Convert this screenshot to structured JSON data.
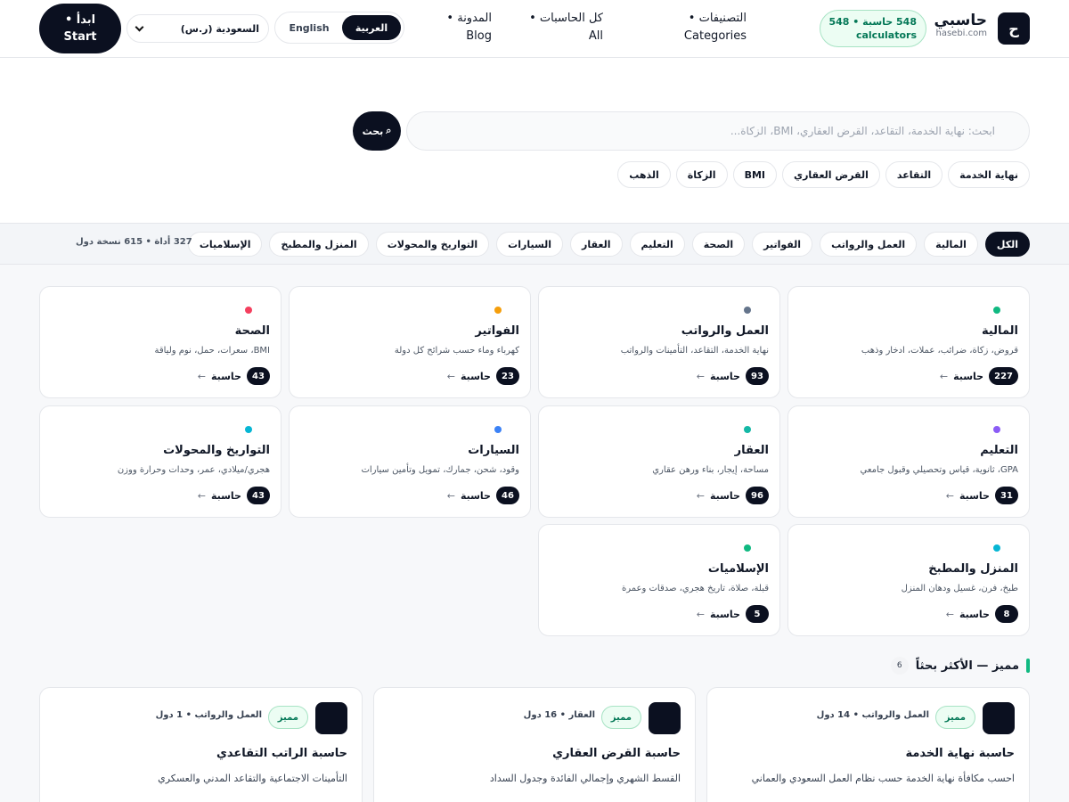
{
  "header": {
    "logo_glyph": "ح",
    "brand_name": "حاسبي",
    "brand_domain": "hasebi.com",
    "count_line1": "548 حاسبة • 548",
    "count_line2": "calculators",
    "nav_categories": "التصنيفات • Categories",
    "nav_all": "كل الحاسبات • All",
    "nav_blog": "المدونة • Blog",
    "lang_ar": "العربية",
    "lang_en": "English",
    "country": "السعودية (ر.س)",
    "start_line1": "ابدأ •",
    "start_line2": "Start"
  },
  "search": {
    "placeholder": "ابحث: نهاية الخدمة، التقاعد، القرض العقاري، BMI، الزكاة...",
    "button_label": "بحث",
    "quick_chips": [
      "نهاية الخدمة",
      "التقاعد",
      "القرض العقاري",
      "BMI",
      "الزكاة",
      "الذهب"
    ]
  },
  "filters": {
    "items": [
      "الكل",
      "المالية",
      "العمل والرواتب",
      "الفواتير",
      "الصحة",
      "التعليم",
      "العقار",
      "السيارات",
      "التواريخ والمحولات",
      "المنزل والمطبخ",
      "الإسلاميات"
    ],
    "stats": "327 أداة • 615 نسخة دول"
  },
  "categories": [
    {
      "name": "المالية",
      "desc": "قروض، زكاة، ضرائب، عملات، ادخار وذهب",
      "count": "227",
      "unit": "حاسبة",
      "dot": "#10b981"
    },
    {
      "name": "العمل والرواتب",
      "desc": "نهاية الخدمة، التقاعد، التأمينات والرواتب",
      "count": "93",
      "unit": "حاسبة",
      "dot": "#64748b"
    },
    {
      "name": "الفواتير",
      "desc": "كهرباء وماء حسب شرائح كل دولة",
      "count": "23",
      "unit": "حاسبة",
      "dot": "#f59e0b"
    },
    {
      "name": "الصحة",
      "desc": "BMI، سعرات، حمل، نوم ولياقة",
      "count": "43",
      "unit": "حاسبة",
      "dot": "#f43f5e"
    },
    {
      "name": "التعليم",
      "desc": "GPA، ثانوية، قياس وتحصيلي وقبول جامعي",
      "count": "31",
      "unit": "حاسبة",
      "dot": "#8b5cf6"
    },
    {
      "name": "العقار",
      "desc": "مساحة، إيجار، بناء ورهن عقاري",
      "count": "96",
      "unit": "حاسبة",
      "dot": "#14b8a6"
    },
    {
      "name": "السيارات",
      "desc": "وقود، شحن، جمارك، تمويل وتأمين سيارات",
      "count": "46",
      "unit": "حاسبة",
      "dot": "#3b82f6"
    },
    {
      "name": "التواريخ والمحولات",
      "desc": "هجري/ميلادي، عمر، وحدات وحرارة ووزن",
      "count": "43",
      "unit": "حاسبة",
      "dot": "#06b6d4"
    },
    {
      "name": "المنزل والمطبخ",
      "desc": "طبخ، فرن، غسيل ودهان المنزل",
      "count": "8",
      "unit": "حاسبة",
      "dot": "#06b6d4"
    },
    {
      "name": "الإسلاميات",
      "desc": "قبلة، صلاة، تاريخ هجري، صدقات وعمرة",
      "count": "5",
      "unit": "حاسبة",
      "dot": "#10b981"
    }
  ],
  "featured": {
    "title": "مميز — الأكثر بحثاً",
    "count": "6",
    "cards": [
      {
        "badge": "مميز",
        "meta": "العمل والرواتب • 14 دول",
        "title": "حاسبة نهاية الخدمة",
        "desc": "احسب مكافأة نهاية الخدمة حسب نظام العمل السعودي والعماني"
      },
      {
        "badge": "مميز",
        "meta": "العقار • 16 دول",
        "title": "حاسبة القرض العقاري",
        "desc": "القسط الشهري وإجمالي الفائدة وجدول السداد"
      },
      {
        "badge": "مميز",
        "meta": "العمل والرواتب • 1 دول",
        "title": "حاسبة الراتب التقاعدي",
        "desc": "التأمينات الاجتماعية والتقاعد المدني والعسكري"
      }
    ]
  },
  "colors": {
    "dark": "#0b1020",
    "accent": "#10b981",
    "badge_bg": "#ecfdf3"
  }
}
